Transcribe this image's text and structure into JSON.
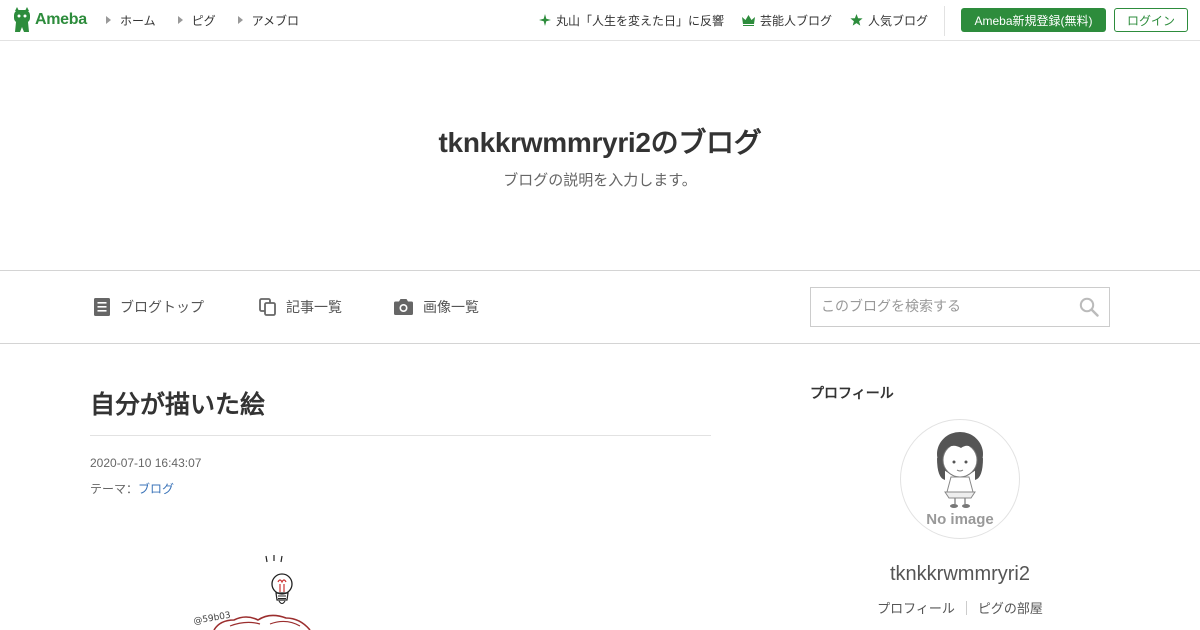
{
  "header": {
    "logo_text": "Ameba",
    "nav": [
      {
        "label": "ホーム"
      },
      {
        "label": "ピグ"
      },
      {
        "label": "アメブロ"
      }
    ],
    "trends": [
      {
        "label": "丸山「人生を変えた日」に反響",
        "icon": "sparkle-icon"
      },
      {
        "label": "芸能人ブログ",
        "icon": "crown-icon"
      },
      {
        "label": "人気ブログ",
        "icon": "star-icon"
      }
    ],
    "register_label": "Ameba新規登録(無料)",
    "login_label": "ログイン",
    "brand_color": "#2d8c3c"
  },
  "blog": {
    "title": "tknkkrwmmryri2のブログ",
    "description": "ブログの説明を入力します。"
  },
  "blog_nav": {
    "items": [
      {
        "label": "ブログトップ",
        "icon": "document-icon"
      },
      {
        "label": "記事一覧",
        "icon": "copy-icon"
      },
      {
        "label": "画像一覧",
        "icon": "camera-icon"
      }
    ],
    "search_placeholder": "このブログを検索する"
  },
  "article": {
    "title": "自分が描いた絵",
    "date": "2020-07-10 16:43:07",
    "theme_prefix": "テーマ：",
    "theme_link": "ブログ",
    "watermark": "@59b03"
  },
  "sidebar": {
    "heading": "プロフィール",
    "avatar_text": "No image",
    "profile_name": "tknkkrwmmryri2",
    "links": [
      {
        "label": "プロフィール"
      },
      {
        "label": "ピグの部屋"
      }
    ]
  }
}
